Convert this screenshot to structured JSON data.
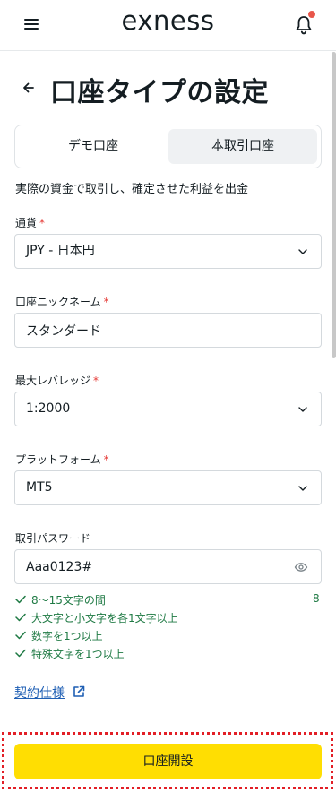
{
  "header": {
    "logo_text": "exness",
    "menu_icon": "hamburger-menu-icon",
    "notification_icon": "bell-icon",
    "notification_dot_color": "#e8564a"
  },
  "page": {
    "back_icon": "arrow-left-icon",
    "title": "口座タイプの設定"
  },
  "account_tabs": {
    "items": [
      {
        "label": "デモ口座",
        "selected": false
      },
      {
        "label": "本取引口座",
        "selected": true
      }
    ]
  },
  "description": "実際の資金で取引し、確定させた利益を出金",
  "form": {
    "currency": {
      "label": "通貨",
      "required_mark": "*",
      "value": "JPY - 日本円"
    },
    "nickname": {
      "label": "口座ニックネーム",
      "required_mark": "*",
      "value": "スタンダード"
    },
    "leverage": {
      "label": "最大レバレッジ",
      "required_mark": "*",
      "value": "1:2000"
    },
    "platform": {
      "label": "プラットフォーム",
      "required_mark": "*",
      "value": "MT5"
    },
    "password": {
      "label": "取引パスワード",
      "value": "Aaa0123#",
      "visibility_icon": "eye-icon"
    }
  },
  "password_rules": {
    "items": [
      {
        "text": "8～15文字の間",
        "count": "8"
      },
      {
        "text": "大文字と小文字を各1文字以上"
      },
      {
        "text": "数字を1つ以上"
      },
      {
        "text": "特殊文字を1つ以上"
      }
    ],
    "check_color": "#1f7a44"
  },
  "contract_link": {
    "label": "契約仕様",
    "icon": "external-link-icon"
  },
  "submit_button": {
    "label": "口座開設",
    "color": "#ffde02"
  },
  "colors": {
    "required": "#e53935",
    "link": "#1f5fb4",
    "highlight_border": "#e21f26"
  }
}
